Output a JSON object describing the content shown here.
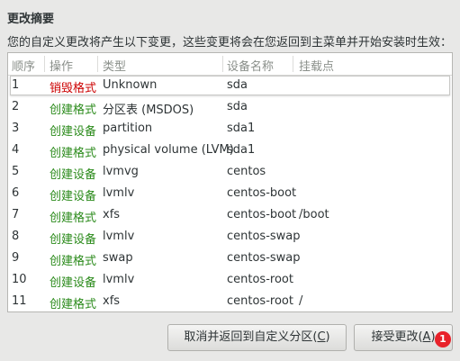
{
  "dialog": {
    "title": "更改摘要",
    "description": "您的自定义更改将产生以下变更，这些变更将会在您返回到主菜单并开始安装时生效："
  },
  "table": {
    "columns": [
      "顺序",
      "操作",
      "类型",
      "设备名称",
      "挂载点"
    ],
    "rows": [
      {
        "order": "1",
        "action": "销毁格式",
        "action_kind": "delete",
        "type": "Unknown",
        "device": "sda",
        "mount": ""
      },
      {
        "order": "2",
        "action": "创建格式",
        "action_kind": "create",
        "type": "分区表 (MSDOS)",
        "device": "sda",
        "mount": ""
      },
      {
        "order": "3",
        "action": "创建设备",
        "action_kind": "create",
        "type": "partition",
        "device": "sda1",
        "mount": ""
      },
      {
        "order": "4",
        "action": "创建格式",
        "action_kind": "create",
        "type": "physical volume (LVM)",
        "device": "sda1",
        "mount": ""
      },
      {
        "order": "5",
        "action": "创建设备",
        "action_kind": "create",
        "type": "lvmvg",
        "device": "centos",
        "mount": ""
      },
      {
        "order": "6",
        "action": "创建设备",
        "action_kind": "create",
        "type": "lvmlv",
        "device": "centos-boot",
        "mount": ""
      },
      {
        "order": "7",
        "action": "创建格式",
        "action_kind": "create",
        "type": "xfs",
        "device": "centos-boot",
        "mount": "/boot"
      },
      {
        "order": "8",
        "action": "创建设备",
        "action_kind": "create",
        "type": "lvmlv",
        "device": "centos-swap",
        "mount": ""
      },
      {
        "order": "9",
        "action": "创建格式",
        "action_kind": "create",
        "type": "swap",
        "device": "centos-swap",
        "mount": ""
      },
      {
        "order": "10",
        "action": "创建设备",
        "action_kind": "create",
        "type": "lvmlv",
        "device": "centos-root",
        "mount": ""
      },
      {
        "order": "11",
        "action": "创建格式",
        "action_kind": "create",
        "type": "xfs",
        "device": "centos-root",
        "mount": "/"
      }
    ],
    "selected_row": "1"
  },
  "buttons": {
    "cancel": {
      "label": "取消并返回到自定义分区(",
      "mnemonic": "C",
      "suffix": ")"
    },
    "accept": {
      "label": "接受更改(",
      "mnemonic": "A",
      "suffix": ")"
    }
  },
  "badge": {
    "count": "1",
    "color": "#e8222a"
  },
  "colors": {
    "delete_action": "#cc0000",
    "create_action": "#2a8a1a",
    "background": "#e8e8e7"
  }
}
